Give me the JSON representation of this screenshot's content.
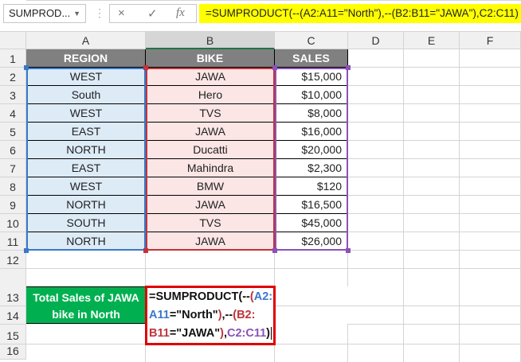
{
  "name_box": "SUMPROD...",
  "formula_bar": "=SUMPRODUCT(--(A2:A11=\"North\"),--(B2:B11=\"JAWA\"),C2:C11)",
  "icons": {
    "cancel": "×",
    "enter": "✓",
    "fx": "fx"
  },
  "columns": [
    "A",
    "B",
    "C",
    "D",
    "E",
    "F"
  ],
  "rows": [
    "1",
    "2",
    "3",
    "4",
    "5",
    "6",
    "7",
    "8",
    "9",
    "10",
    "11",
    "12",
    "13",
    "14",
    "15",
    "16"
  ],
  "headers": [
    "REGION",
    "BIKE",
    "SALES"
  ],
  "data": [
    [
      "WEST",
      "JAWA",
      "$15,000"
    ],
    [
      "South",
      "Hero",
      "$10,000"
    ],
    [
      "WEST",
      "TVS",
      "$8,000"
    ],
    [
      "EAST",
      "JAWA",
      "$16,000"
    ],
    [
      "NORTH",
      "Ducatti",
      "$20,000"
    ],
    [
      "EAST",
      "Mahindra",
      "$2,300"
    ],
    [
      "WEST",
      "BMW",
      "$120"
    ],
    [
      "NORTH",
      "JAWA",
      "$16,500"
    ],
    [
      "SOUTH",
      "TVS",
      "$45,000"
    ],
    [
      "NORTH",
      "JAWA",
      "$26,000"
    ]
  ],
  "label_cell": "Total Sales of JAWA bike in North",
  "edit_parts": {
    "p1": "=SUMPRODUCT(--",
    "p2": "(",
    "p3": "A2:",
    "p4": "A11",
    "p5": "=\"North\"",
    "p6": ")",
    "p7": ",--",
    "p8": "(",
    "p9": "B2:",
    "p10": "B11",
    "p11": "=\"JAWA\"",
    "p12": ")",
    "p13": ",",
    "p14": "C2:C11",
    "p15": ")"
  }
}
